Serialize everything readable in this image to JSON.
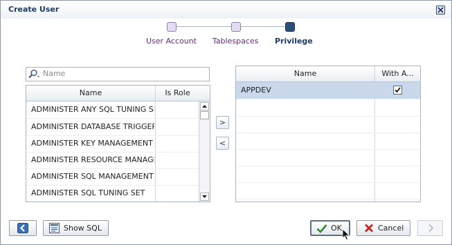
{
  "dialog": {
    "title": "Create User"
  },
  "train": {
    "steps": [
      {
        "label": "User Account",
        "state": "visited"
      },
      {
        "label": "Tablespaces",
        "state": "visited"
      },
      {
        "label": "Privilege",
        "state": "current"
      }
    ]
  },
  "search": {
    "placeholder": "Name",
    "value": ""
  },
  "available_table": {
    "columns": [
      "Name",
      "Is Role"
    ],
    "rows": [
      "ADMINISTER ANY SQL TUNING SET",
      "ADMINISTER DATABASE TRIGGER",
      "ADMINISTER KEY MANAGEMENT",
      "ADMINISTER RESOURCE MANAGER",
      "ADMINISTER SQL MANAGEMENT OBJECT",
      "ADMINISTER SQL TUNING SET"
    ]
  },
  "shuttle": {
    "move_right": ">",
    "move_left": "<"
  },
  "selected_table": {
    "columns": [
      "Name",
      "With A..."
    ],
    "rows": [
      {
        "name": "APPDEV",
        "with_admin": true
      }
    ]
  },
  "footer": {
    "show_sql": "Show SQL",
    "ok": "OK",
    "cancel": "Cancel"
  },
  "colors": {
    "accent": "#1d3b66",
    "visited_step": "#6b2a7e",
    "selected_row": "#c9d8ea",
    "ok_check": "#2e8b2e",
    "cancel_x": "#c0251e"
  }
}
